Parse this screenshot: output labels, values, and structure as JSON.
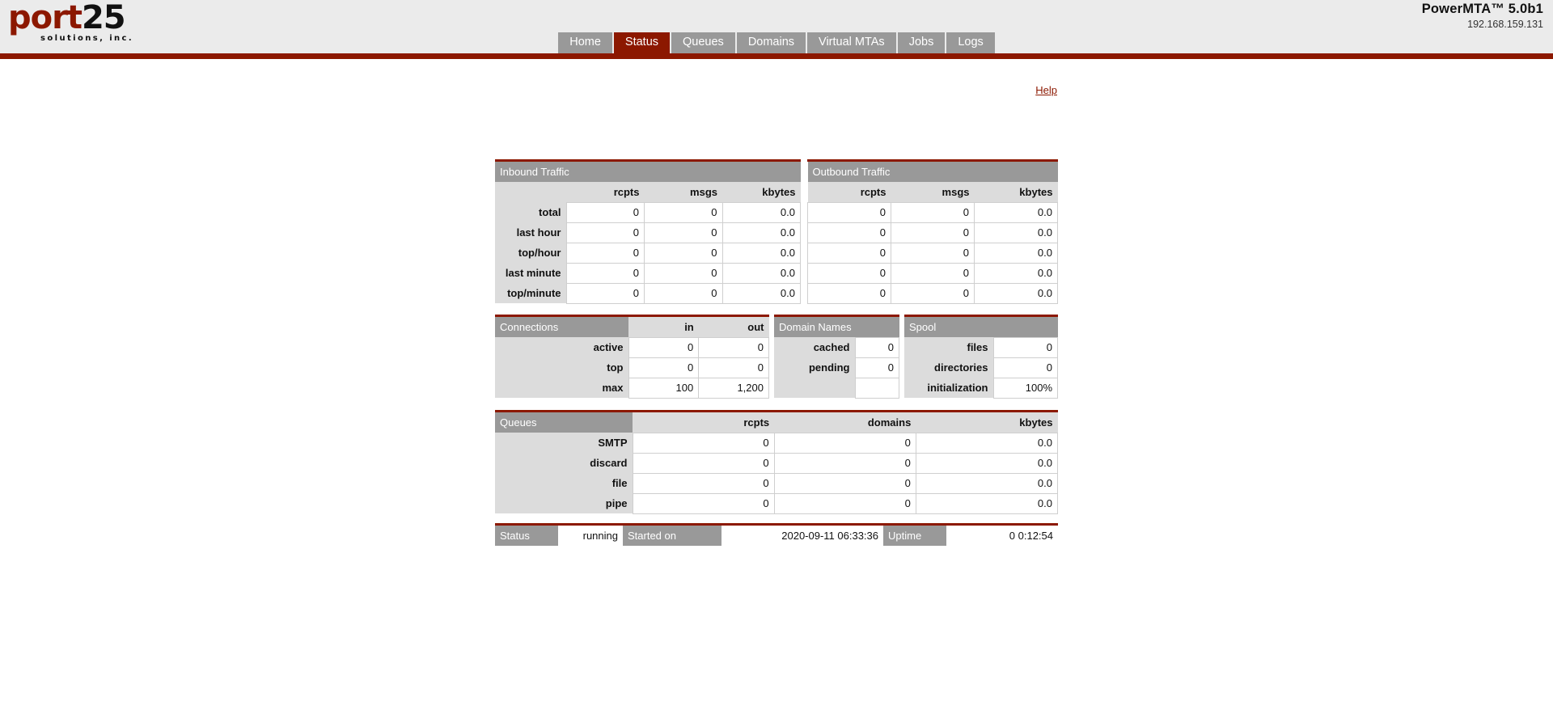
{
  "header": {
    "logo": {
      "part1": "port",
      "part2": "25",
      "tagline": "solutions, inc."
    },
    "product_title": "PowerMTA™ 5.0b1",
    "ip_address": "192.168.159.131"
  },
  "nav": {
    "tabs": [
      {
        "label": "Home",
        "active": false
      },
      {
        "label": "Status",
        "active": true
      },
      {
        "label": "Queues",
        "active": false
      },
      {
        "label": "Domains",
        "active": false
      },
      {
        "label": "Virtual MTAs",
        "active": false
      },
      {
        "label": "Jobs",
        "active": false
      },
      {
        "label": "Logs",
        "active": false
      }
    ]
  },
  "help": {
    "label": "Help"
  },
  "inbound": {
    "title": "Inbound Traffic",
    "columns": [
      "rcpts",
      "msgs",
      "kbytes"
    ],
    "rows": [
      {
        "label": "total",
        "values": [
          "0",
          "0",
          "0.0"
        ]
      },
      {
        "label": "last hour",
        "values": [
          "0",
          "0",
          "0.0"
        ]
      },
      {
        "label": "top/hour",
        "values": [
          "0",
          "0",
          "0.0"
        ]
      },
      {
        "label": "last minute",
        "values": [
          "0",
          "0",
          "0.0"
        ]
      },
      {
        "label": "top/minute",
        "values": [
          "0",
          "0",
          "0.0"
        ]
      }
    ]
  },
  "outbound": {
    "title": "Outbound Traffic",
    "columns": [
      "rcpts",
      "msgs",
      "kbytes"
    ],
    "rows": [
      {
        "label": "total",
        "values": [
          "0",
          "0",
          "0.0"
        ]
      },
      {
        "label": "last hour",
        "values": [
          "0",
          "0",
          "0.0"
        ]
      },
      {
        "label": "top/hour",
        "values": [
          "0",
          "0",
          "0.0"
        ]
      },
      {
        "label": "last minute",
        "values": [
          "0",
          "0",
          "0.0"
        ]
      },
      {
        "label": "top/minute",
        "values": [
          "0",
          "0",
          "0.0"
        ]
      }
    ]
  },
  "connections": {
    "title": "Connections",
    "columns": [
      "in",
      "out"
    ],
    "rows": [
      {
        "label": "active",
        "values": [
          "0",
          "0"
        ]
      },
      {
        "label": "top",
        "values": [
          "0",
          "0"
        ]
      },
      {
        "label": "max",
        "values": [
          "100",
          "1,200"
        ]
      }
    ]
  },
  "domain_names": {
    "title": "Domain Names",
    "rows": [
      {
        "label": "cached",
        "value": "0"
      },
      {
        "label": "pending",
        "value": "0"
      }
    ]
  },
  "spool": {
    "title": "Spool",
    "rows": [
      {
        "label": "files",
        "value": "0"
      },
      {
        "label": "directories",
        "value": "0"
      },
      {
        "label": "initialization",
        "value": "100%"
      }
    ]
  },
  "queues": {
    "title": "Queues",
    "columns": [
      "rcpts",
      "domains",
      "kbytes"
    ],
    "rows": [
      {
        "label": "SMTP",
        "values": [
          "0",
          "0",
          "0.0"
        ]
      },
      {
        "label": "discard",
        "values": [
          "0",
          "0",
          "0.0"
        ]
      },
      {
        "label": "file",
        "values": [
          "0",
          "0",
          "0.0"
        ]
      },
      {
        "label": "pipe",
        "values": [
          "0",
          "0",
          "0.0"
        ]
      }
    ]
  },
  "statusbar": {
    "status_label": "Status",
    "status_value": "running",
    "started_label": "Started on",
    "started_value": "2020-09-11 06:33:36",
    "uptime_label": "Uptime",
    "uptime_value": "0 0:12:54"
  },
  "colors": {
    "accent_red": "#8c1800",
    "header_gray": "#999999",
    "cell_gray": "#dcdcdc",
    "page_header_bg": "#ebebeb"
  }
}
